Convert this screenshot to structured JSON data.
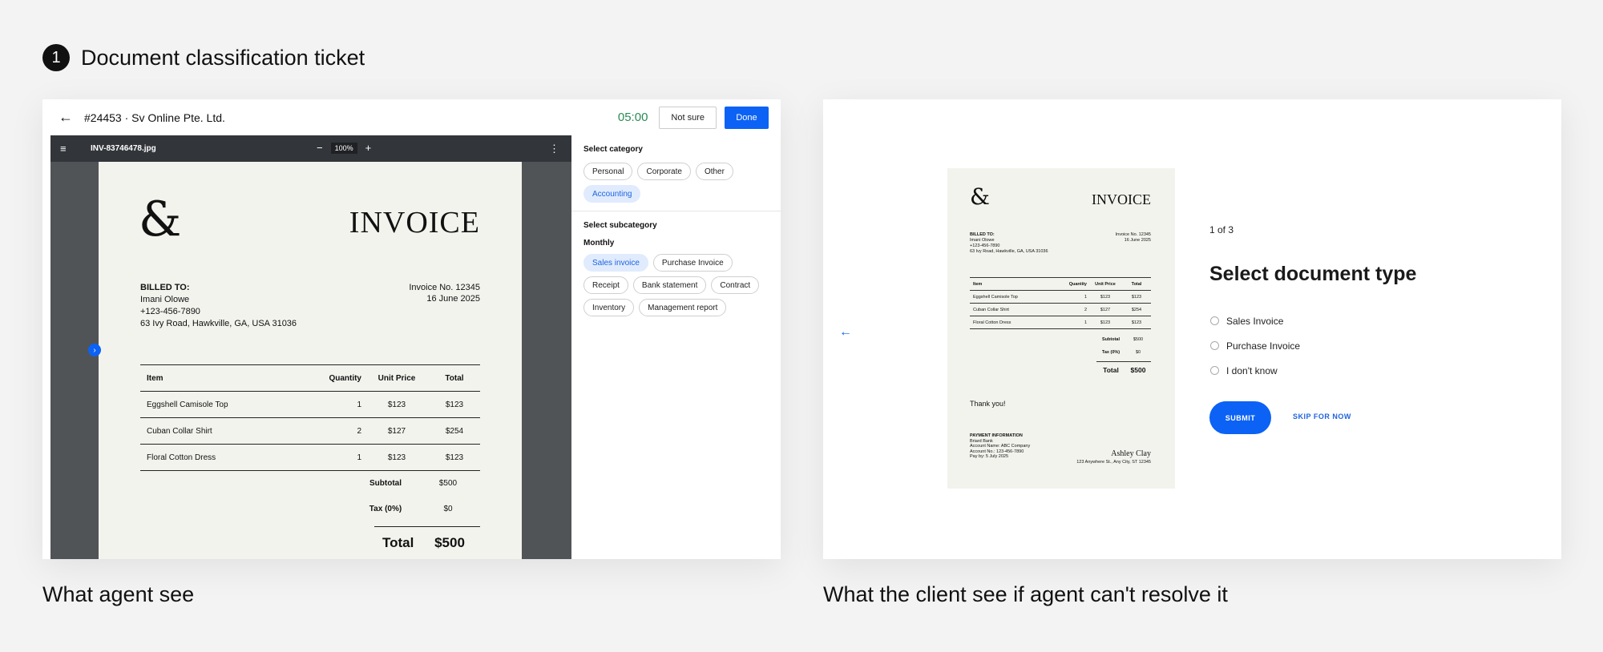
{
  "heading": {
    "step": "1",
    "title": "Document classification ticket"
  },
  "captions": {
    "agent": "What agent see",
    "client": "What the client see if agent can't resolve it"
  },
  "agent": {
    "back_icon": "arrow-left-icon",
    "ticket_title": "#24453 · Sv Online Pte. Ltd.",
    "timer": "05:00",
    "not_sure_label": "Not sure",
    "done_label": "Done",
    "colors": {
      "primary": "#0b62f5",
      "timer": "#2a8a55",
      "viewer_bg": "#505457",
      "toolbar_bg": "#323539",
      "chip_selected_bg": "#e0ebfd"
    },
    "viewer": {
      "file_name": "INV-83746478.jpg",
      "zoom": "100%",
      "zoom_out": "−",
      "zoom_in": "+",
      "menu_icon": "≡",
      "more_icon": "⋮",
      "next_icon": "›"
    },
    "categories": {
      "title": "Select category",
      "items": [
        "Personal",
        "Corporate",
        "Other",
        "Accounting"
      ],
      "selected": "Accounting"
    },
    "subcategories": {
      "title": "Select subcategory",
      "group": "Monthly",
      "items": [
        "Sales invoice",
        "Purchase Invoice",
        "Receipt",
        "Bank statement",
        "Contract",
        "Inventory",
        "Management report"
      ],
      "selected": "Sales invoice"
    }
  },
  "invoice": {
    "logo": "&",
    "title": "INVOICE",
    "billed_label": "BILLED TO:",
    "billed_name": "Imani Olowe",
    "billed_phone": "+123-456-7890",
    "billed_address": "63 Ivy Road, Hawkville, GA, USA 31036",
    "number": "Invoice No. 12345",
    "date": "16 June 2025",
    "columns": [
      "Item",
      "Quantity",
      "Unit Price",
      "Total"
    ],
    "rows": [
      [
        "Eggshell Camisole Top",
        "1",
        "$123",
        "$123"
      ],
      [
        "Cuban Collar Shirt",
        "2",
        "$127",
        "$254"
      ],
      [
        "Floral Cotton Dress",
        "1",
        "$123",
        "$123"
      ]
    ],
    "subtotal_label": "Subtotal",
    "subtotal": "$500",
    "tax_label": "Tax (0%)",
    "tax": "$0",
    "total_label": "Total",
    "total": "$500",
    "thanks": "Thank you!",
    "payment_label": "PAYMENT INFORMATION",
    "payment_bank": "Briard Bank",
    "payment_account_name": "Account Name: ABC Company",
    "payment_account_no": "Account No.: 123-456-7890",
    "payment_due": "Pay by: 5 July 2025",
    "signature_name": "Ashley Clay",
    "signature_address": "123 Anywhere St., Any City, ST 12345"
  },
  "client": {
    "back_icon": "arrow-left-icon",
    "progress": "1 of 3",
    "question": "Select document type",
    "options": [
      "Sales Invoice",
      "Purchase Invoice",
      "I don't know"
    ],
    "submit_label": "SUBMIT",
    "skip_label": "SKIP FOR NOW"
  }
}
